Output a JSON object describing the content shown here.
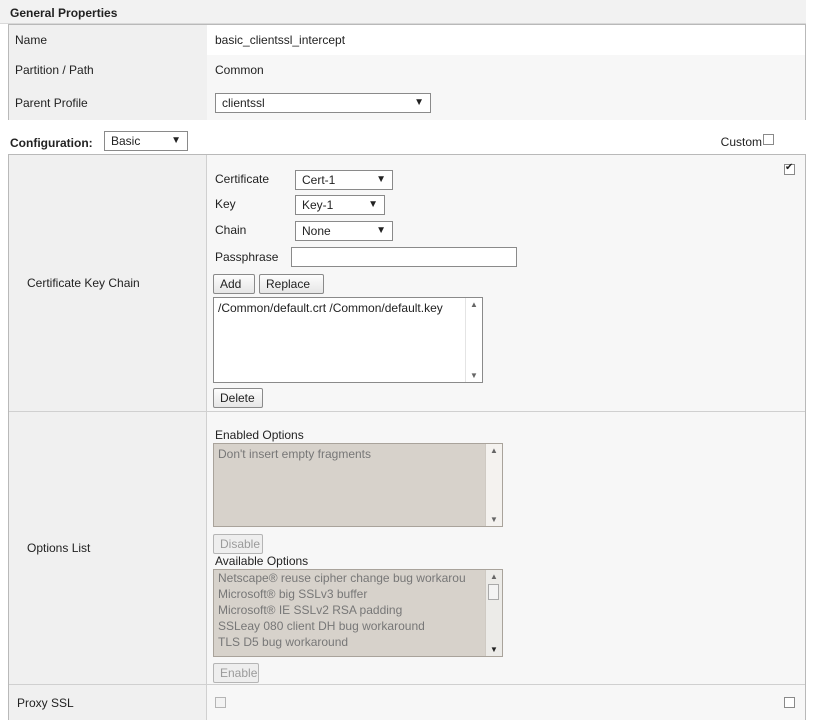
{
  "general": {
    "header": "General Properties",
    "rows": [
      {
        "label": "Name",
        "value": "basic_clientssl_intercept"
      },
      {
        "label": "Partition / Path",
        "value": "Common"
      },
      {
        "label": "Parent Profile",
        "value": "clientssl"
      }
    ]
  },
  "configuration": {
    "label": "Configuration:",
    "value": "Basic",
    "custom_label": "Custom"
  },
  "cert_chain": {
    "label": "Certificate Key Chain",
    "certificate_label": "Certificate",
    "certificate_value": "Cert-1",
    "key_label": "Key",
    "key_value": "Key-1",
    "chain_label": "Chain",
    "chain_value": "None",
    "passphrase_label": "Passphrase",
    "add_label": "Add",
    "replace_label": "Replace",
    "list_items": [
      "/Common/default.crt /Common/default.key"
    ],
    "delete_label": "Delete"
  },
  "options": {
    "label": "Options List",
    "enabled_label": "Enabled Options",
    "enabled_items": [
      "Don't insert empty fragments"
    ],
    "disable_label": "Disable",
    "available_label": "Available Options",
    "available_items": [
      "Netscape® reuse cipher change bug workarou",
      "Microsoft® big SSLv3 buffer",
      "Microsoft® IE SSLv2 RSA padding",
      "SSLeay 080 client DH bug workaround",
      "TLS D5 bug workaround"
    ],
    "enable_label": "Enable"
  },
  "proxy": {
    "label": "Proxy SSL"
  }
}
